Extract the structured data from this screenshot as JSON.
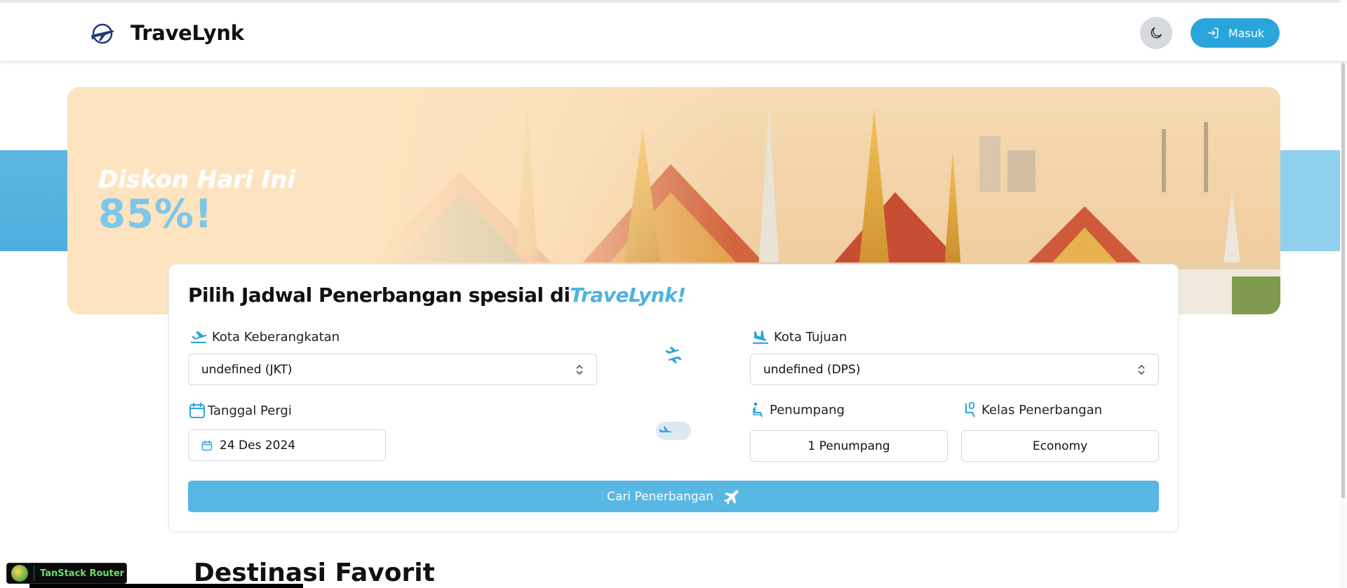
{
  "navbar": {
    "brand": "TraveLynk",
    "login_label": "Masuk"
  },
  "hero": {
    "discount_label": "Diskon Hari Ini",
    "discount_value": "85%!"
  },
  "search_card": {
    "title_prefix": "Pilih Jadwal Penerbangan spesial di",
    "title_accent": "TraveLynk!",
    "departure": {
      "label": "Kota Keberangkatan",
      "value": "undefined (JKT)"
    },
    "destination": {
      "label": "Kota Tujuan",
      "value": "undefined (DPS)"
    },
    "date": {
      "label": "Tanggal Pergi",
      "value": "24 Des 2024"
    },
    "passengers": {
      "label": "Penumpang",
      "value": "1 Penumpang"
    },
    "flight_class": {
      "label": "Kelas Penerbangan",
      "value": "Economy"
    },
    "round_trip_toggle": false,
    "search_button": "Cari Penerbangan"
  },
  "favorites": {
    "title": "Destinasi Favorit"
  },
  "devtools": {
    "label": "TanStack Router"
  },
  "colors": {
    "accent": "#2aa5dc",
    "button": "#58b8e3",
    "hero_bg": "#fde2bd"
  }
}
